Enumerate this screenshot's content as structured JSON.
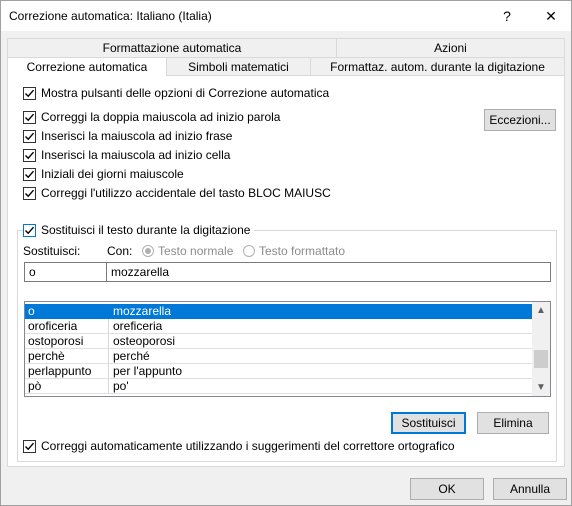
{
  "window": {
    "title": "Correzione automatica: Italiano (Italia)",
    "help": "?",
    "close": "✕"
  },
  "tabs": {
    "row1": [
      "Formattazione automatica",
      "Azioni"
    ],
    "row2": [
      "Correzione automatica",
      "Simboli matematici",
      "Formattaz. autom. durante la digitazione"
    ]
  },
  "options": {
    "show_buttons": "Mostra pulsanti delle opzioni di Correzione automatica",
    "two_initial_caps": "Correggi la doppia maiuscola ad inizio parola",
    "capitalize_sentence": "Inserisci la maiuscola ad inizio frase",
    "capitalize_cell": "Inserisci la maiuscola ad inizio cella",
    "capitalize_days": "Iniziali dei giorni maiuscole",
    "caps_lock": "Correggi l'utilizzo accidentale del tasto BLOC MAIUSC",
    "exceptions_button": "Eccezioni...",
    "replace_text": "Sostituisci il testo durante la digitazione"
  },
  "replace": {
    "replace_label": "Sostituisci:",
    "with_label": "Con:",
    "plain_text": "Testo normale",
    "formatted_text": "Testo formattato",
    "replace_value": "o",
    "with_value": "mozzarella"
  },
  "list": [
    {
      "from": "o",
      "to": "mozzarella",
      "selected": true
    },
    {
      "from": "oroficeria",
      "to": "oreficeria"
    },
    {
      "from": "ostoporosi",
      "to": "osteoporosi"
    },
    {
      "from": "perchè",
      "to": "perché"
    },
    {
      "from": "perlappunto",
      "to": "per l'appunto"
    },
    {
      "from": "pò",
      "to": "po'"
    }
  ],
  "buttons": {
    "replace": "Sostituisci",
    "delete": "Elimina",
    "ok": "OK",
    "cancel": "Annulla"
  },
  "spellcheck": "Correggi automaticamente utilizzando i suggerimenti del correttore ortografico",
  "colors": {
    "accent": "#0078d7",
    "check": "#000000"
  }
}
